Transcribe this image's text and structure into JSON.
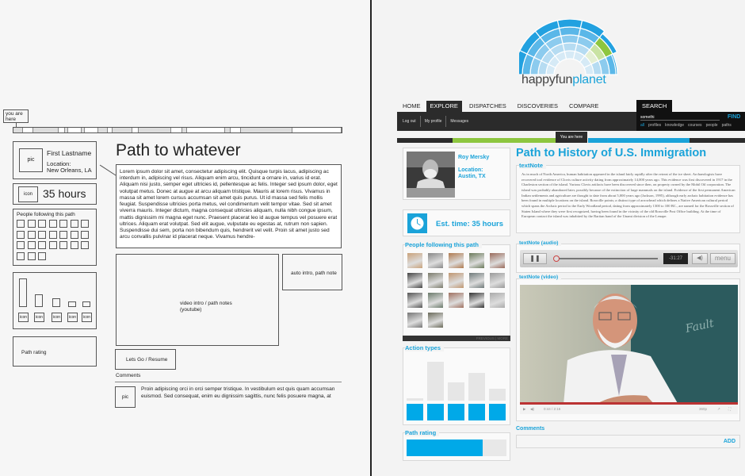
{
  "wireframe": {
    "you_are_here": "you are here",
    "progress_segments": [
      {
        "w": 12,
        "f": 1
      },
      {
        "w": 13,
        "f": 0
      },
      {
        "w": 31,
        "f": 1
      },
      {
        "w": 8,
        "f": 0
      },
      {
        "w": 4,
        "f": 1
      },
      {
        "w": 17,
        "f": 0
      },
      {
        "w": 4,
        "f": 1
      },
      {
        "w": 16,
        "f": 0
      },
      {
        "w": 12,
        "f": 1
      },
      {
        "w": 6,
        "f": 0
      },
      {
        "w": 25,
        "f": 1
      },
      {
        "w": 8,
        "f": 0
      },
      {
        "w": 40,
        "f": 1
      },
      {
        "w": 14,
        "f": 0
      },
      {
        "w": 6,
        "f": 1
      },
      {
        "w": 47,
        "f": 0
      },
      {
        "w": 7,
        "f": 1
      },
      {
        "w": 13,
        "f": 0
      },
      {
        "w": 64,
        "f": 1
      },
      {
        "w": 61,
        "f": 0
      }
    ],
    "profile": {
      "pic": "pic",
      "name": "First Lastname",
      "location_label": "Location:",
      "location": "New Orleans, LA"
    },
    "time": {
      "icon": "icon",
      "value": "35 hours"
    },
    "followers": {
      "title": "People following this path",
      "count": 24
    },
    "action_bars": [
      1.0,
      0.45,
      0.3,
      0.2,
      0.2
    ],
    "action_icon_label": "icon",
    "rating_label": "Path rating",
    "title": "Path to whatever",
    "body": "Lorem ipsum dolor sit amet, consectetur adipiscing elit. Quisque turpis lacus, adipiscing ac interdum in, adipiscing vel risus. Aliquam enim arcu, tincidunt a ornare in, varius id erat. Aliquam nisi justo, semper eget ultricies id, pellentesque ac felis. Integer sed ipsum dolor, eget volutpat metus. Donec at augue at arcu aliquam tristique. Mauris at lorem risus. Vivamus in massa sit amet lorem cursus accumsan sit amet quis purus. Ut id massa sed felis mollis feugiat. Suspendisse ultricies porta metus, vel condimentum velit tempor vitae. Sed sit amet viverra mauris. Integer dictum, magna consequat ultricies aliquam, nulla nibh congue ipsum, mattis dignissim mi magna eget nunc. Praesent placerat leo id augue tempus vel posuere erat ultrices. Aliquam erat volutpat. Sed elit augue, vulputate eu egestas at, rutrum non sapien. Suspendisse dui sem, porta non bibendum quis, hendrerit vel velit. Proin sit amet justo sed arcu convallis pulvinar id placerat neque. Vivamus hendre-",
    "video_label_1": "video intro / path notes",
    "video_label_2": "(youtube)",
    "auto_intro": "auto intro, path note",
    "go_button": "Lets Go / Resume",
    "comments_label": "Comments",
    "comment_pic": "pic",
    "comment_text": "Proin adipiscing orci in orci semper tristique. In vestibulum est quis quam accumsan euismod. Sed consequat, enim eu dignissim sagittis, nunc felis posuere magna, at"
  },
  "design": {
    "brand": {
      "part1": "happyfun",
      "part2": "planet"
    },
    "colors": {
      "accent": "#1aa3d9",
      "green": "#8dc63f",
      "dark": "#2b2b2b"
    },
    "nav": [
      "HOME",
      "EXPLORE",
      "DISPATCHES",
      "DISCOVERIES",
      "COMPARE"
    ],
    "active_nav": "EXPLORE",
    "subnav": [
      "Log out",
      "My profile",
      "Messages"
    ],
    "search": {
      "tab": "SEARCH",
      "value": "somethi",
      "find": "FIND",
      "filters": [
        "all",
        "profiles",
        "knowledge",
        "courses",
        "people",
        "paths"
      ],
      "active_filter": "all"
    },
    "you_are_here": "You are here",
    "profile": {
      "name": "Roy Mersky",
      "location_label": "Location:",
      "location": "Austin, TX"
    },
    "est_time": "Est. time: 35 hours",
    "followers_title": "People following this path",
    "followers_count": 17,
    "pager": "PREVIOUS | MORE",
    "action_types_title": "Action types",
    "action_levels": [
      0.05,
      0.85,
      0.4,
      0.6,
      0.25
    ],
    "rating_title": "Path rating",
    "rating_value": 0.76,
    "title": "Path to History of U.S. Immigration",
    "textnote_label": "textNote",
    "textnote": "As in much of North America, human habitation appeared in the island fairly rapidly after the retreat of the ice sheet. Archaeologists have recovered tool evidence of Clovis culture activity dating from approximately 14,000 years ago. This evidence was first discovered in 1917 in the Charleston section of the island. Various Clovis artifacts have been discovered since then, on property owned by the Mobil Oil corporation. The island was probably abandoned later, possibly because of the extinction of large mammals on the island. Evidence of the first permanent American Indian settlements and agriculture are thought to date from about 5,000 years ago (Jackson, 1995), although early archaic habitation evidence has been found in multiple locations on the island. Rossville points; a distinct type of arrowhead which defines a Native American cultural period which spans the Archaic period to the Early Woodland period, dating from approximately 1300 to 100 BC., are named for the Rossville section of Staten Island where they were first recognized, having been found in the vicinity of the old Rossville Post Office building. At the time of European contact the island was inhabited by the Raritan band of the Unami division of the Lenape.",
    "audio_label": "textNote (audio)",
    "audio_time": "-31:27",
    "audio_menu": "menu",
    "video_label": "textNote (video)",
    "video_time": "0:44 / 2:16",
    "video_quality": "360p",
    "comments_label": "Comments",
    "add_label": "ADD"
  }
}
